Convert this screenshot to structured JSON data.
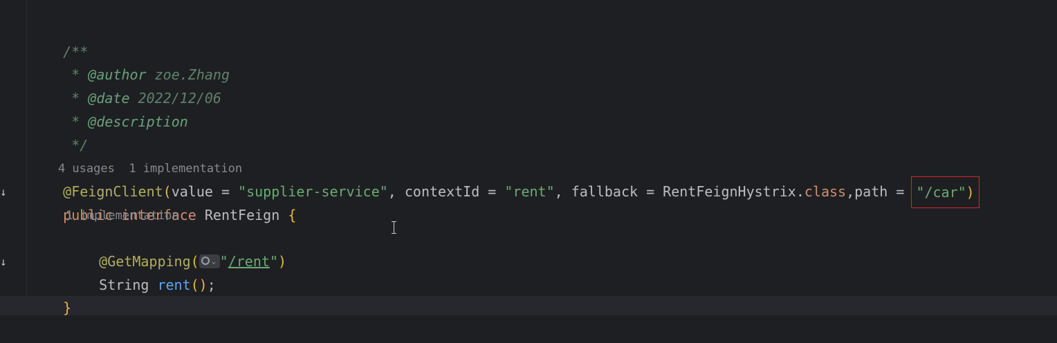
{
  "editor": {
    "doc_comment": {
      "open": "/**",
      "author_prefix": " * ",
      "author_tag": "@author",
      "author_value": " zoe.Zhang",
      "date_prefix": " * ",
      "date_tag": "@date",
      "date_value": " 2022/12/06",
      "desc_prefix": " * ",
      "desc_tag": "@description",
      "close": " */"
    },
    "usages_hint": "4 usages",
    "impl_hint": "1 implementation",
    "annotation_line": {
      "annotation": "@FeignClient",
      "open_paren": "(",
      "part1": "value = ",
      "value_str": "\"supplier-service\"",
      "part2": ", contextId = ",
      "context_str": "\"rent\"",
      "part3": ", fallback = RentFeignHystrix.",
      "class_kw": "class",
      "part4": ",path = ",
      "path_str": "\"/car\"",
      "close_paren": ")"
    },
    "interface_line": {
      "kw_public": "public",
      "kw_interface": "interface",
      "name": "RentFeign",
      "brace": "{"
    },
    "method_hint": "1 implementation",
    "mapping_line": {
      "annotation": "@GetMapping",
      "open_paren": "(",
      "quote_open": "\"",
      "url": "/rent",
      "quote_close": "\"",
      "close_paren": ")"
    },
    "method_line": {
      "return_type": "String",
      "method_name": "rent",
      "parens": "()",
      "semicolon": ";"
    },
    "closing_brace": "}"
  },
  "icons": {
    "gutter": "implementation-gutter-icon",
    "globe": "globe-icon",
    "cursor": "text-cursor-icon"
  },
  "colors": {
    "background": "#1e1f22",
    "highlight_border": "#d2262b"
  }
}
